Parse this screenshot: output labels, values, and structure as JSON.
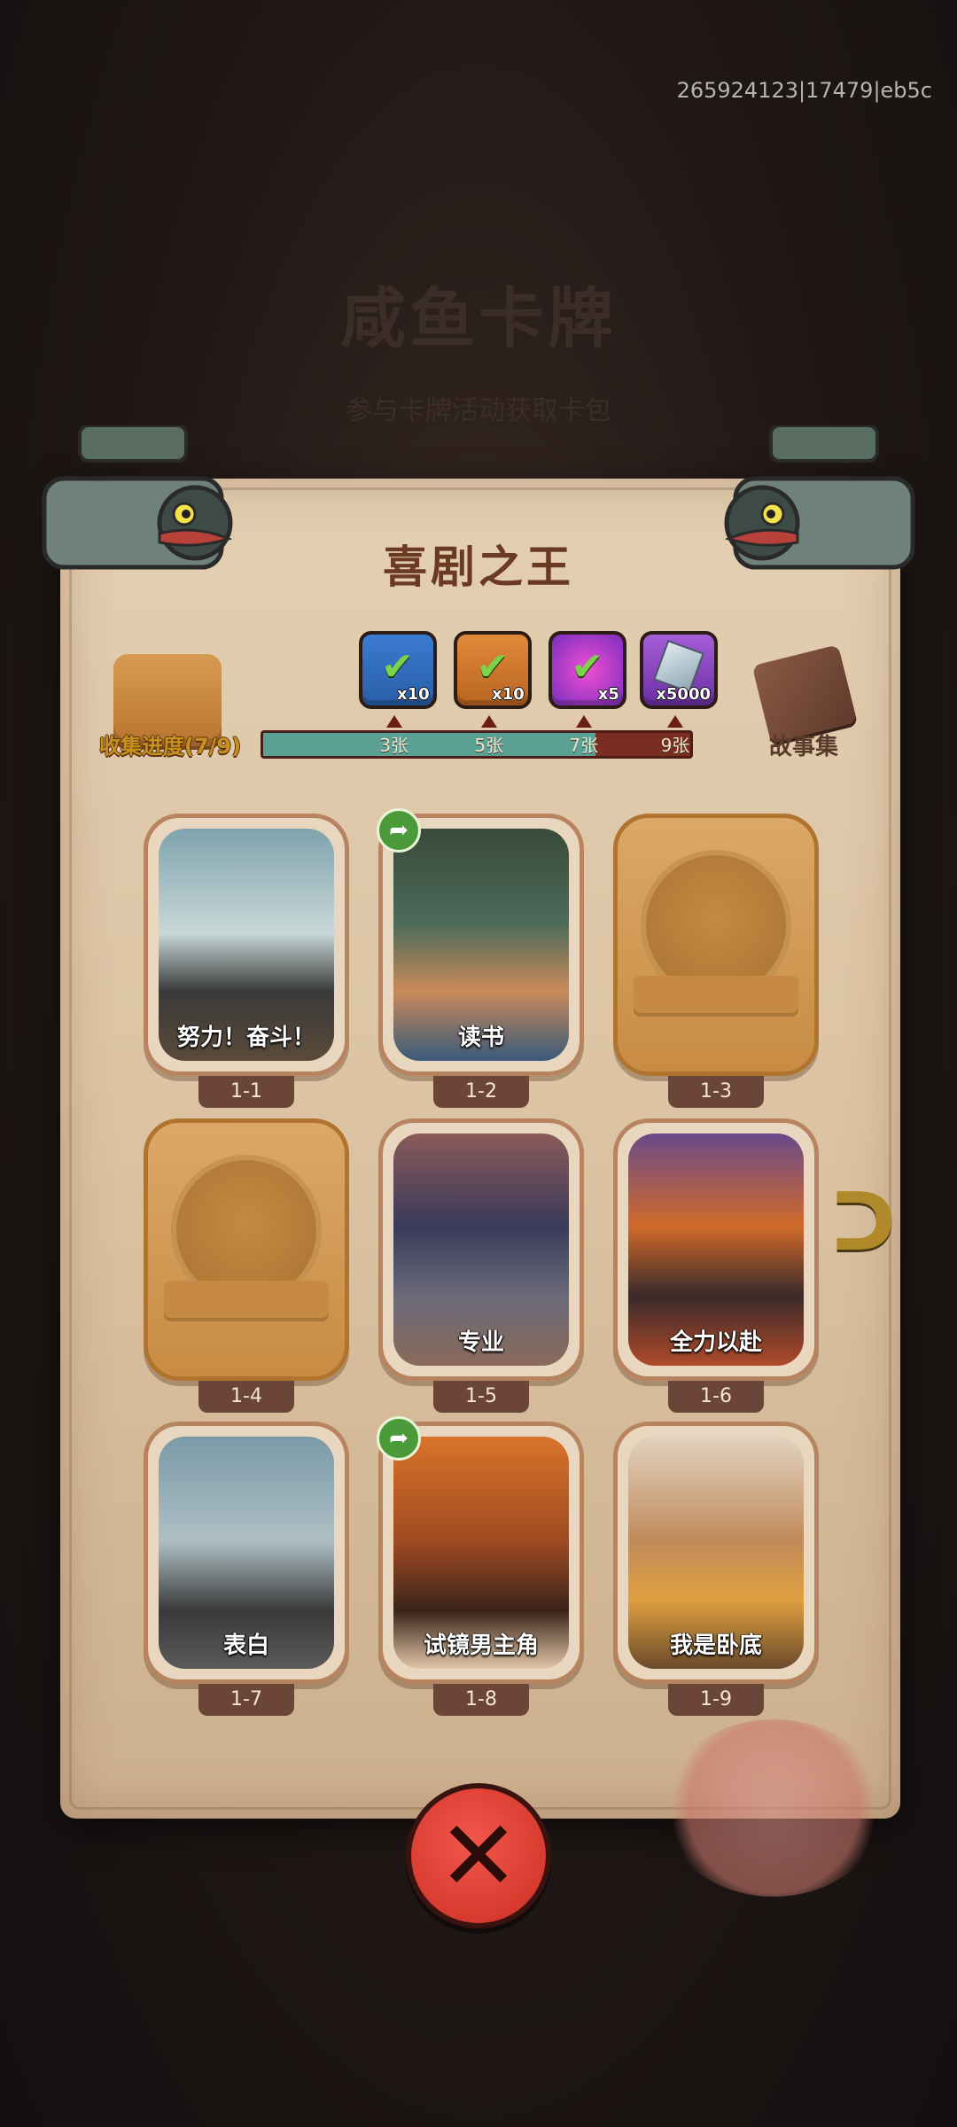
{
  "session_id": "265924123|17479|eb5c",
  "background": {
    "title": "咸鱼卡牌",
    "subtitle": "参与卡牌活动获取卡包"
  },
  "panel": {
    "title": "喜剧之王",
    "collect_label": "收集进度(7/9)",
    "story_label": "故事集",
    "progress": {
      "collected": 7,
      "total": 9,
      "milestones": [
        {
          "label": "3张",
          "reward_count": "x10",
          "reward_icon": "hammer-chest-icon",
          "claimed": true
        },
        {
          "label": "5张",
          "reward_count": "x10",
          "reward_icon": "scroll-chest-icon",
          "claimed": true
        },
        {
          "label": "7张",
          "reward_count": "x5",
          "reward_icon": "orb-icon",
          "claimed": true
        },
        {
          "label": "9张",
          "reward_count": "x5000",
          "reward_icon": "crystal-icon",
          "claimed": false
        }
      ]
    },
    "cards": [
      {
        "id": "1-1",
        "title": "努力！奋斗！",
        "locked": false,
        "shared": false
      },
      {
        "id": "1-2",
        "title": "读书",
        "locked": false,
        "shared": true
      },
      {
        "id": "1-3",
        "title": "",
        "locked": true,
        "shared": false
      },
      {
        "id": "1-4",
        "title": "",
        "locked": true,
        "shared": false
      },
      {
        "id": "1-5",
        "title": "专业",
        "locked": false,
        "shared": false
      },
      {
        "id": "1-6",
        "title": "全力以赴",
        "locked": false,
        "shared": false
      },
      {
        "id": "1-7",
        "title": "表白",
        "locked": false,
        "shared": false
      },
      {
        "id": "1-8",
        "title": "试镜男主角",
        "locked": false,
        "shared": true
      },
      {
        "id": "1-9",
        "title": "我是卧底",
        "locked": false,
        "shared": false
      }
    ]
  },
  "colors": {
    "parchment": "#dcc4a4",
    "progress_fill": "#5aa194",
    "progress_track": "#7b2d22",
    "close_button": "#d83a2e"
  }
}
